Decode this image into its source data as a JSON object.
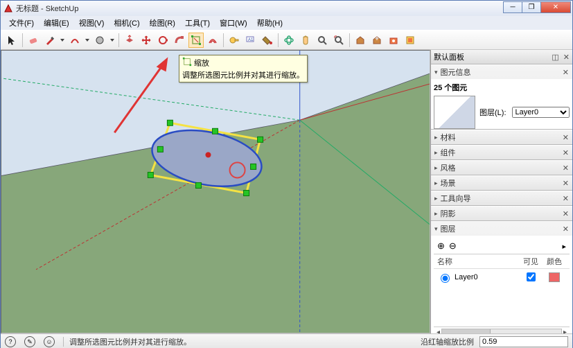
{
  "window": {
    "title": "无标题 - SketchUp"
  },
  "menu": {
    "items": [
      "文件(F)",
      "编辑(E)",
      "视图(V)",
      "相机(C)",
      "绘图(R)",
      "工具(T)",
      "窗口(W)",
      "帮助(H)"
    ]
  },
  "tooltip": {
    "title": "缩放",
    "body": "调整所选图元比例并对其进行缩放。"
  },
  "tray": {
    "title": "默认面板",
    "entity_info": {
      "title": "图元信息",
      "count_label": "25 个图元",
      "layer_label": "图层(L):",
      "layer_value": "Layer0"
    },
    "panels": {
      "materials": "材料",
      "components": "组件",
      "styles": "风格",
      "scenes": "场景",
      "instructor": "工具向导",
      "shadows": "阴影",
      "layers": "图层"
    },
    "layers": {
      "name_col": "名称",
      "visible_col": "可见",
      "color_col": "颜色",
      "rows": [
        {
          "name": "Layer0",
          "visible": true
        }
      ]
    }
  },
  "status": {
    "hint": "调整所选图元比例并对其进行缩放。",
    "measure_label": "沿红轴缩放比例",
    "measure_value": "0.59"
  },
  "icons": {
    "select": "select-icon",
    "eraser": "eraser-icon",
    "pencil": "pencil-icon",
    "arc": "arc-icon",
    "rect": "rect-icon",
    "circle": "circle-icon",
    "polygon": "polygon-icon",
    "pushpull": "pushpull-icon",
    "move": "move-icon",
    "rotate": "rotate-icon",
    "followme": "followme-icon",
    "scale": "scale-icon",
    "offset": "offset-icon",
    "tape": "tape-icon",
    "text": "text-icon",
    "paint": "paint-icon",
    "orbit": "orbit-icon",
    "pan": "pan-icon",
    "zoom": "zoom-icon",
    "zoomext": "zoomext-icon",
    "warehouse1": "warehouse-icon",
    "warehouse2": "warehouse-share-icon",
    "ext1": "ext-icon",
    "ext2": "ext2-icon"
  }
}
